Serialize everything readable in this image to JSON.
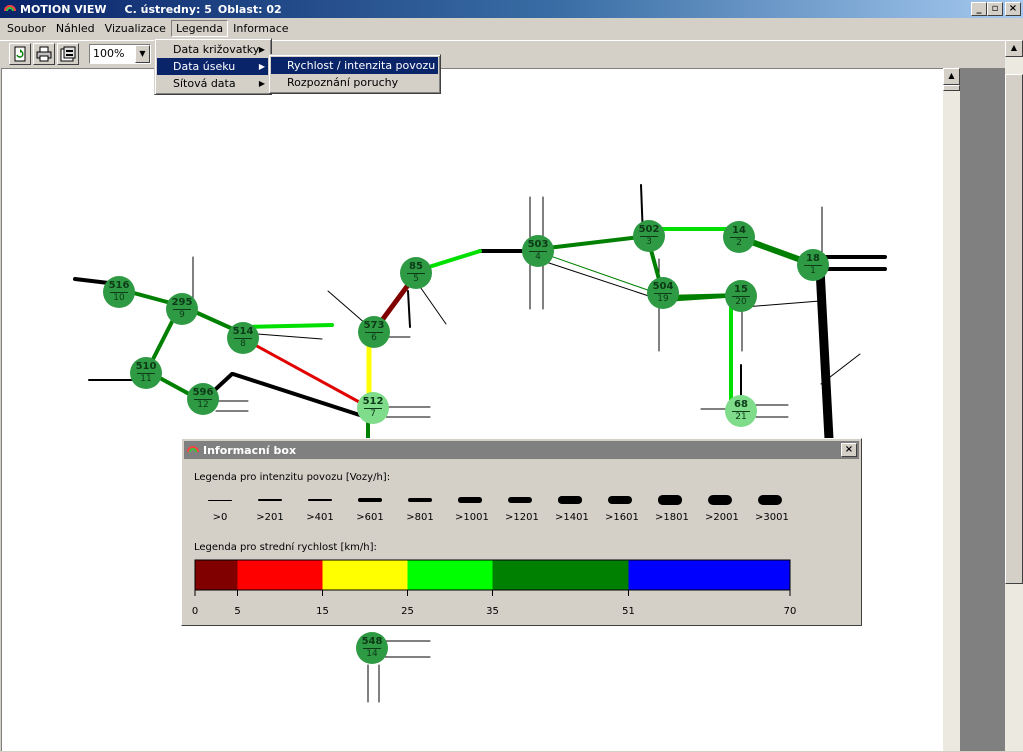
{
  "window": {
    "app_name": "MOTION VIEW",
    "station": "C. ústredny: 5",
    "area": "Oblast: 02",
    "minimize": "_",
    "restore": "▫",
    "close": "×"
  },
  "menubar": {
    "items": [
      {
        "label": "Soubor"
      },
      {
        "label": "Náhled"
      },
      {
        "label": "Vizualizace"
      },
      {
        "label": "Legenda"
      },
      {
        "label": "Informace"
      }
    ]
  },
  "toolbar": {
    "zoom": "100%"
  },
  "legend_menu": {
    "items": [
      {
        "label": "Data križovatky"
      },
      {
        "label": "Data úseku"
      },
      {
        "label": "Sítová data"
      }
    ],
    "submenu": [
      {
        "label": "Rychlost / intenzita povozu"
      },
      {
        "label": "Rozpoznání poruchy"
      }
    ]
  },
  "nodes": [
    {
      "id": "516",
      "num": "10"
    },
    {
      "id": "295",
      "num": "9"
    },
    {
      "id": "514",
      "num": "8"
    },
    {
      "id": "510",
      "num": "11"
    },
    {
      "id": "596",
      "num": "12"
    },
    {
      "id": "85",
      "num": "5"
    },
    {
      "id": "573",
      "num": "6"
    },
    {
      "id": "512",
      "num": "7"
    },
    {
      "id": "503",
      "num": "4"
    },
    {
      "id": "502",
      "num": "3"
    },
    {
      "id": "504",
      "num": "19"
    },
    {
      "id": "14",
      "num": "2"
    },
    {
      "id": "15",
      "num": "20"
    },
    {
      "id": "18",
      "num": "1"
    },
    {
      "id": "68",
      "num": "21"
    },
    {
      "id": "548",
      "num": "14"
    }
  ],
  "infobox": {
    "title": "Informacní box",
    "close": "×",
    "intensity_label": "Legenda pro intenzitu povozu [Vozy/h]:",
    "intensity_levels": [
      ">0",
      ">201",
      ">401",
      ">601",
      ">801",
      ">1001",
      ">1201",
      ">1401",
      ">1601",
      ">1801",
      ">2001",
      ">3001"
    ],
    "speed_label": "Legenda pro strední rychlost [km/h]:",
    "speed_ticks": [
      "0",
      "5",
      "15",
      "25",
      "35",
      "51",
      "70"
    ],
    "speed_bands": [
      {
        "from": 0,
        "to": 5,
        "color": "#800000"
      },
      {
        "from": 5,
        "to": 15,
        "color": "#ff0000"
      },
      {
        "from": 15,
        "to": 25,
        "color": "#ffff00"
      },
      {
        "from": 25,
        "to": 35,
        "color": "#00ff00"
      },
      {
        "from": 35,
        "to": 51,
        "color": "#008000"
      },
      {
        "from": 51,
        "to": 70,
        "color": "#0000ff"
      }
    ]
  }
}
